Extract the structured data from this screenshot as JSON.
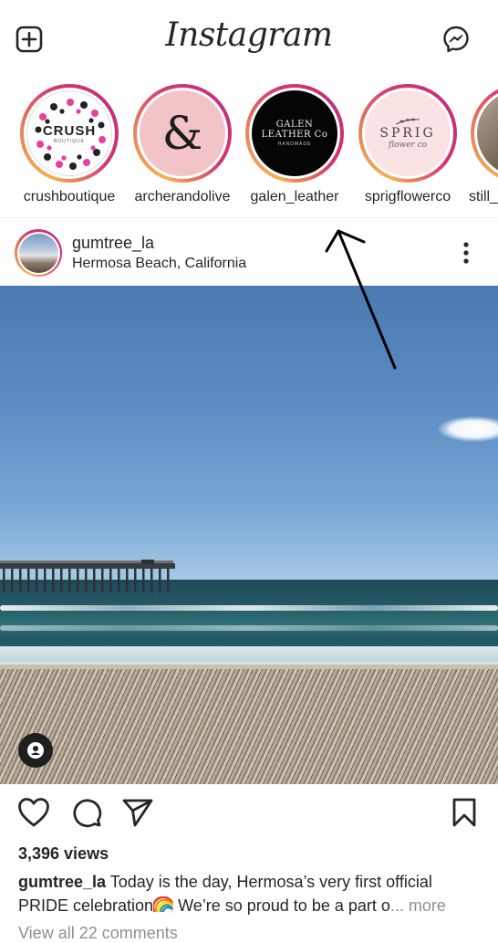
{
  "app": {
    "title": "Instagram",
    "icons": {
      "new_post": "plus-square-icon",
      "messenger": "messenger-icon"
    }
  },
  "stories": [
    {
      "username": "crushboutique",
      "avatar_text": "CRUSH",
      "avatar_subtext": "BOUTIQUE"
    },
    {
      "username": "archerandolive",
      "avatar_text": "&"
    },
    {
      "username": "galen_leather",
      "avatar_text": "GALEN LEATHER Co",
      "avatar_subtext": "HANDMADE"
    },
    {
      "username": "sprigflowerco",
      "avatar_text": "SPRIG",
      "avatar_subtext": "flower co"
    },
    {
      "username": "still_"
    }
  ],
  "post": {
    "username": "gumtree_la",
    "location": "Hermosa Beach, California",
    "options_icon": "more-vertical-icon",
    "media_type": "video",
    "user_tag_icon": "user-tag-icon",
    "actions": {
      "like": "heart-icon",
      "comment": "comment-icon",
      "share": "send-icon",
      "save": "bookmark-icon"
    },
    "views": "3,396 views",
    "caption": {
      "username": "gumtree_la",
      "text_part1": " Today is the day, Hermosa’s very first official PRIDE celebration",
      "emoji": "rainbow",
      "text_part2": " We’re so proud to be a part o",
      "ellipsis": "... ",
      "more": "more"
    },
    "comments_link": "View all 22 comments"
  },
  "annotation": {
    "type": "arrow",
    "points_to": "galen_leather story"
  }
}
